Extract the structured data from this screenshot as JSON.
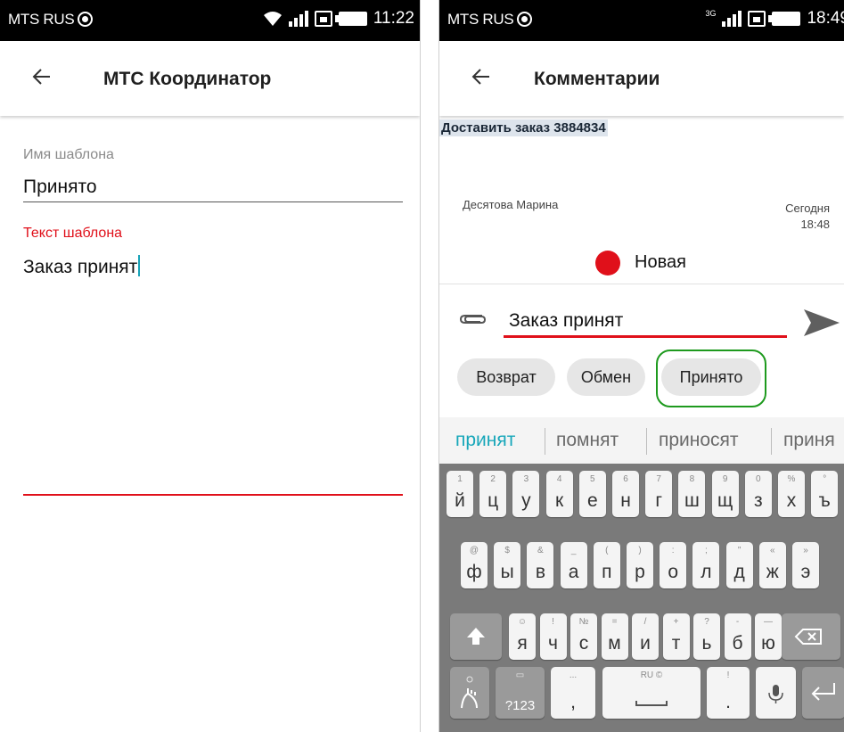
{
  "left_screen": {
    "status": {
      "carrier": "MTS RUS",
      "time": "11:22"
    },
    "header": {
      "title": "МТС Координатор"
    },
    "form": {
      "name_label": "Имя шаблона",
      "name_value": "Принято",
      "text_label": "Текст шаблона",
      "text_value": "Заказ принят"
    },
    "colors": {
      "accent": "#e0101a",
      "cursor": "#19a3b8"
    }
  },
  "right_screen": {
    "status": {
      "carrier": "MTS RUS",
      "network": "3G",
      "time": "18:49"
    },
    "header": {
      "title": "Комментарии"
    },
    "order_title": "Доставить заказ 3884834",
    "comment": {
      "author": "Десятова Марина",
      "day": "Сегодня",
      "time": "18:48"
    },
    "order_status": {
      "label": "Новая",
      "color": "#e0101a"
    },
    "input": {
      "value": "Заказ принят"
    },
    "chips": [
      "Возврат",
      "Обмен",
      "Принято"
    ],
    "suggestions": [
      "принят",
      "помнят",
      "приносят",
      "приня"
    ],
    "keyboard": {
      "row1": [
        {
          "hint": "1",
          "key": "й"
        },
        {
          "hint": "2",
          "key": "ц"
        },
        {
          "hint": "3",
          "key": "у"
        },
        {
          "hint": "4",
          "key": "к"
        },
        {
          "hint": "5",
          "key": "е"
        },
        {
          "hint": "6",
          "key": "н"
        },
        {
          "hint": "7",
          "key": "г"
        },
        {
          "hint": "8",
          "key": "ш"
        },
        {
          "hint": "9",
          "key": "щ"
        },
        {
          "hint": "0",
          "key": "з"
        },
        {
          "hint": "%",
          "key": "х"
        },
        {
          "hint": "°",
          "key": "ъ"
        }
      ],
      "row2": [
        {
          "hint": "@",
          "key": "ф"
        },
        {
          "hint": "$",
          "key": "ы"
        },
        {
          "hint": "&",
          "key": "в"
        },
        {
          "hint": "_",
          "key": "а"
        },
        {
          "hint": "(",
          "key": "п"
        },
        {
          "hint": ")",
          "key": "р"
        },
        {
          "hint": ":",
          "key": "о"
        },
        {
          "hint": ";",
          "key": "л"
        },
        {
          "hint": "\"",
          "key": "д"
        },
        {
          "hint": "«",
          "key": "ж"
        },
        {
          "hint": "»",
          "key": "э"
        }
      ],
      "row3": [
        {
          "hint": "☺",
          "key": "я"
        },
        {
          "hint": "!",
          "key": "ч"
        },
        {
          "hint": "№",
          "key": "с"
        },
        {
          "hint": "=",
          "key": "м"
        },
        {
          "hint": "/",
          "key": "и"
        },
        {
          "hint": "+",
          "key": "т"
        },
        {
          "hint": "?",
          "key": "ь"
        },
        {
          "hint": "-",
          "key": "б"
        },
        {
          "hint": "—",
          "key": "ю"
        }
      ],
      "symbols_label": "?123",
      "comma_label": ",",
      "comma_hint": "...",
      "space_hint": "RU ©",
      "period_label": ".",
      "period_hint": "!"
    }
  }
}
